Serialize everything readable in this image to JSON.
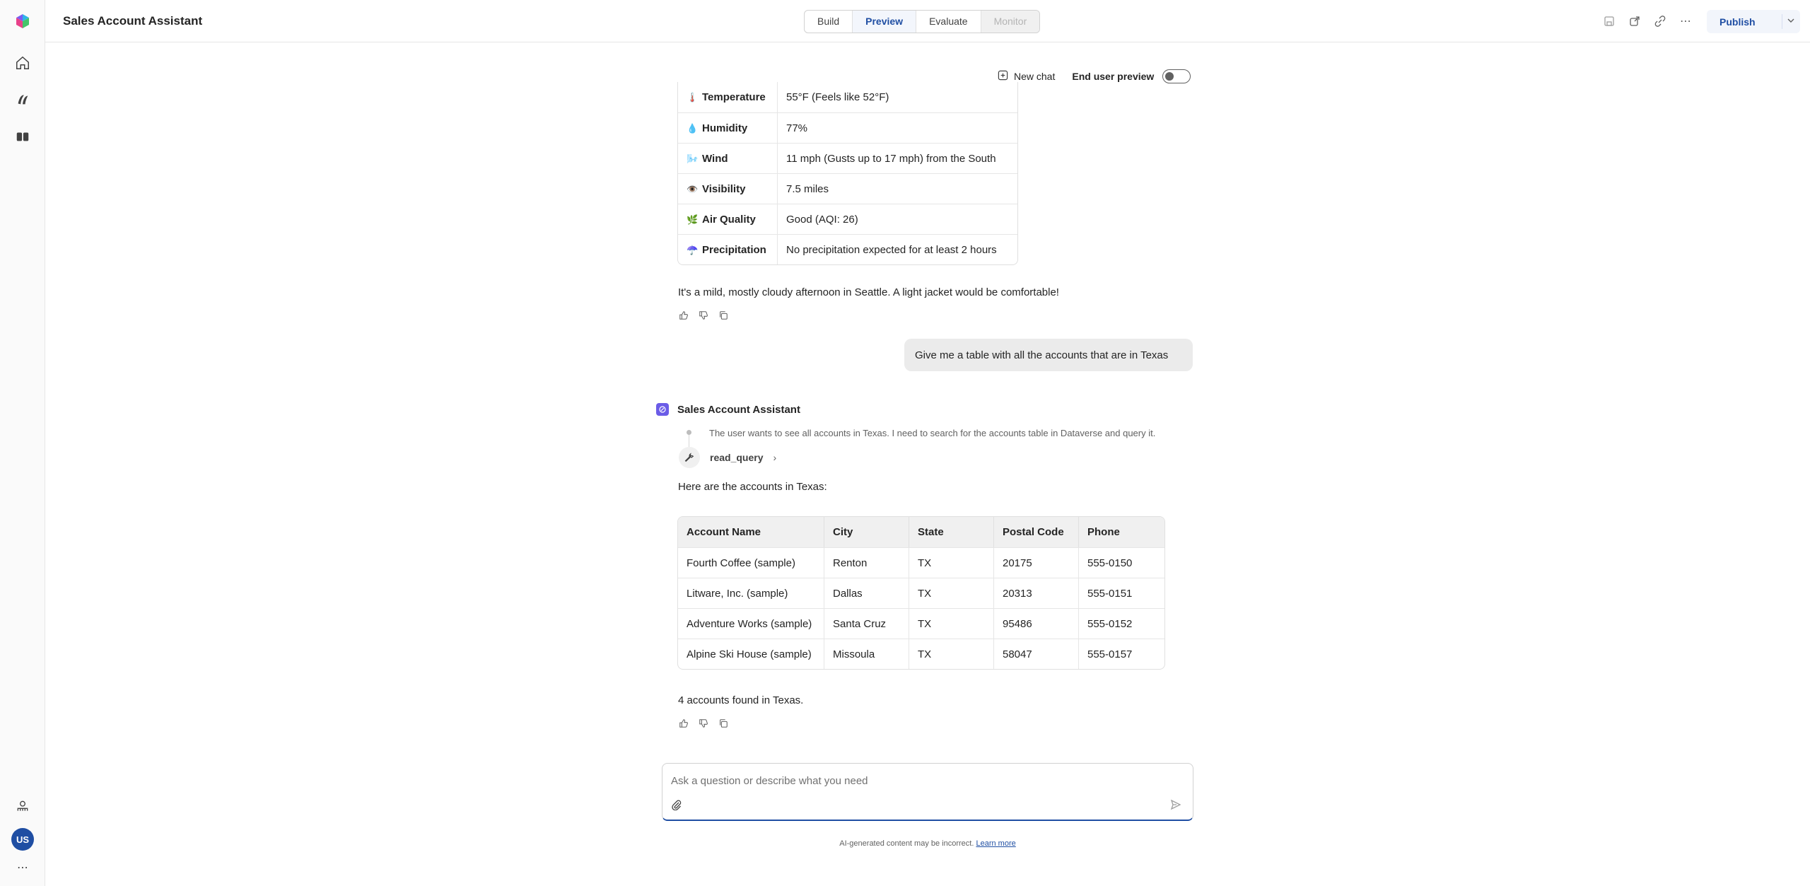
{
  "app": {
    "title": "Sales Account Assistant"
  },
  "tabs": [
    {
      "label": "Build",
      "state": "normal"
    },
    {
      "label": "Preview",
      "state": "active"
    },
    {
      "label": "Evaluate",
      "state": "normal"
    },
    {
      "label": "Monitor",
      "state": "disabled"
    }
  ],
  "header": {
    "publish_label": "Publish"
  },
  "rail": {
    "avatar_initials": "US"
  },
  "chat_toolbar": {
    "new_chat_label": "New chat",
    "end_user_preview_label": "End user preview"
  },
  "weather": {
    "rows": [
      {
        "emoji": "🌡️",
        "label": "Temperature",
        "value": "55°F (Feels like 52°F)"
      },
      {
        "emoji": "💧",
        "label": "Humidity",
        "value": "77%"
      },
      {
        "emoji": "🌬️",
        "label": "Wind",
        "value": "11 mph (Gusts up to 17 mph) from the South"
      },
      {
        "emoji": "👁️",
        "label": "Visibility",
        "value": "7.5 miles"
      },
      {
        "emoji": "🌿",
        "label": "Air Quality",
        "value": "Good (AQI: 26)"
      },
      {
        "emoji": "☂️",
        "label": "Precipitation",
        "value": "No precipitation expected for at least 2 hours"
      }
    ],
    "summary": "It's a mild, mostly cloudy afternoon in Seattle. A light jacket would be comfortable!"
  },
  "user_message": "Give me a table with all the accounts that are in Texas",
  "bot": {
    "name": "Sales Account Assistant",
    "thought": "The user wants to see all accounts in Texas. I need to search for the accounts table in Dataverse and query it.",
    "tool_name": "read_query",
    "intro": "Here are the accounts in Texas:",
    "footer": "4 accounts found in Texas."
  },
  "accounts": {
    "headers": [
      "Account Name",
      "City",
      "State",
      "Postal Code",
      "Phone"
    ],
    "rows": [
      [
        "Fourth Coffee (sample)",
        "Renton",
        "TX",
        "20175",
        "555-0150"
      ],
      [
        "Litware, Inc. (sample)",
        "Dallas",
        "TX",
        "20313",
        "555-0151"
      ],
      [
        "Adventure Works (sample)",
        "Santa Cruz",
        "TX",
        "95486",
        "555-0152"
      ],
      [
        "Alpine Ski House (sample)",
        "Missoula",
        "TX",
        "58047",
        "555-0157"
      ]
    ]
  },
  "composer": {
    "placeholder": "Ask a question or describe what you need"
  },
  "disclaimer": {
    "text": "AI-generated content may be incorrect.",
    "link": "Learn more"
  },
  "colors": {
    "accent": "#1f4ea3",
    "bot_avatar": "#6b5ce7",
    "user_bubble": "#ebebeb"
  }
}
